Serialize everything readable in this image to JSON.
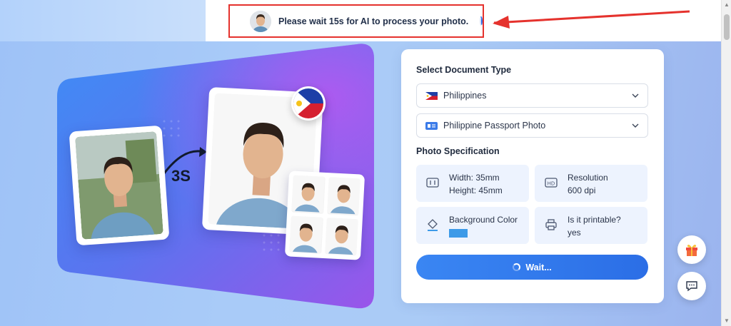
{
  "notice": {
    "message": "Please wait 15s for AI to process your photo."
  },
  "hero": {
    "speed_label": "3S"
  },
  "panel": {
    "document_type_heading": "Select Document Type",
    "country_select": {
      "value": "Philippines",
      "icon": "philippines-flag-icon"
    },
    "document_select": {
      "value": "Philippine Passport Photo",
      "icon": "id-card-icon"
    },
    "spec_heading": "Photo Specification",
    "specs": [
      {
        "icon": "size-icon",
        "line1": "Width: 35mm",
        "line2": "Height: 45mm"
      },
      {
        "icon": "hd-icon",
        "line1": "Resolution",
        "line2": "600 dpi"
      },
      {
        "icon": "paint-bucket-icon",
        "line1": "Background Color",
        "swatch_color": "#3d9ae8"
      },
      {
        "icon": "printer-icon",
        "line1": "Is it printable?",
        "line2": "yes"
      }
    ],
    "wait_button": "Wait..."
  },
  "floating": {
    "gift_icon": "gift-icon",
    "chat_icon": "chat-icon"
  },
  "colors": {
    "accent": "#2f6ee8",
    "annotation": "#e5322d"
  }
}
